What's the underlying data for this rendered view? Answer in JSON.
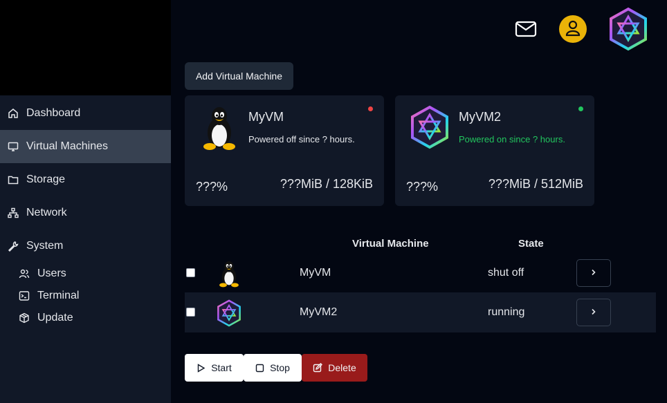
{
  "sidebar": {
    "items": [
      {
        "label": "Dashboard",
        "icon": "home-icon"
      },
      {
        "label": "Virtual Machines",
        "icon": "monitor-icon"
      },
      {
        "label": "Storage",
        "icon": "folder-icon"
      },
      {
        "label": "Network",
        "icon": "network-icon"
      },
      {
        "label": "System",
        "icon": "wrench-icon"
      }
    ],
    "sub_items": [
      {
        "label": "Users",
        "icon": "users-icon"
      },
      {
        "label": "Terminal",
        "icon": "terminal-icon"
      },
      {
        "label": "Update",
        "icon": "package-icon"
      }
    ]
  },
  "header": {
    "add_button": "Add Virtual Machine"
  },
  "cards": [
    {
      "name": "MyVM",
      "status": "Powered off since ? hours.",
      "cpu": "???%",
      "memory": "???MiB / 128KiB",
      "status_color": "#ef4444"
    },
    {
      "name": "MyVM2",
      "status": "Powered on since ? hours.",
      "cpu": "???%",
      "memory": "???MiB / 512MiB",
      "status_color": "#22c55e"
    }
  ],
  "table": {
    "columns": [
      "Virtual Machine",
      "State"
    ],
    "rows": [
      {
        "name": "MyVM",
        "state": "shut off",
        "os_icon": "linux-penguin-icon"
      },
      {
        "name": "MyVM2",
        "state": "running",
        "os_icon": "hexagon-logo-icon"
      }
    ],
    "row_button": "›"
  },
  "actions": {
    "start": "Start",
    "stop": "Stop",
    "delete": "Delete"
  }
}
